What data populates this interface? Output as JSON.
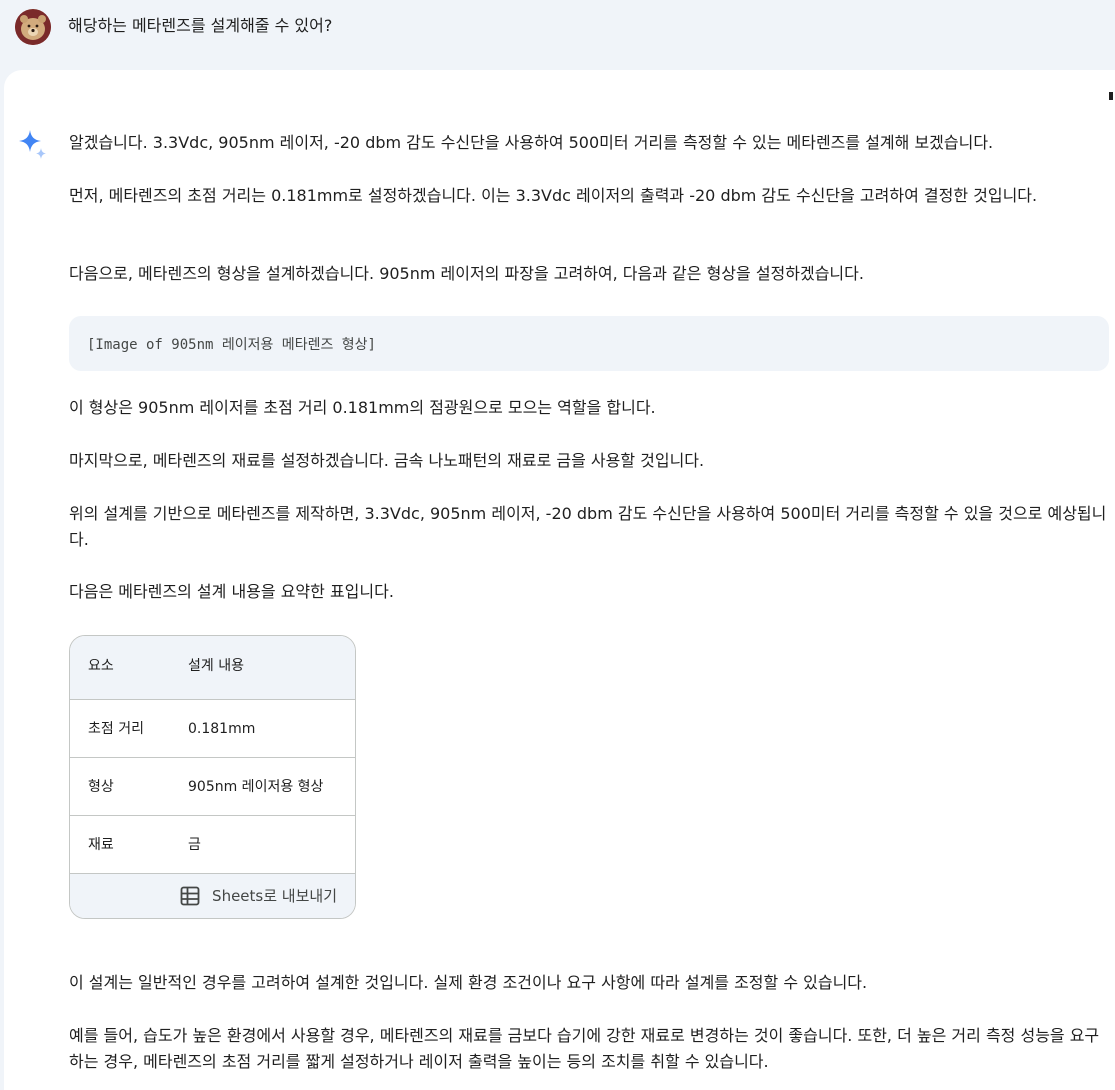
{
  "prompt": {
    "text": "해당하는 메타렌즈를 설계해줄 수 있어?"
  },
  "response": {
    "paragraphs": [
      "알겠습니다. 3.3Vdc, 905nm 레이저, -20 dbm 감도 수신단을 사용하여 500미터 거리를 측정할 수 있는 메타렌즈를 설계해 보겠습니다.",
      "먼저, 메타렌즈의 초점 거리는 0.181mm로 설정하겠습니다. 이는 3.3Vdc 레이저의 출력과 -20 dbm 감도 수신단을 고려하여 결정한 것입니다.",
      "다음으로, 메타렌즈의 형상을 설계하겠습니다. 905nm 레이저의 파장을 고려하여, 다음과 같은 형상을 설정하겠습니다.",
      "이 형상은 905nm 레이저를 초점 거리 0.181mm의 점광원으로 모으는 역할을 합니다.",
      "마지막으로, 메타렌즈의 재료를 설정하겠습니다. 금속 나노패턴의 재료로 금을 사용할 것입니다.",
      "위의 설계를 기반으로 메타렌즈를 제작하면, 3.3Vdc, 905nm 레이저, -20 dbm 감도 수신단을 사용하여 500미터 거리를 측정할 수 있을 것으로 예상됩니다.",
      "다음은 메타렌즈의 설계 내용을 요약한 표입니다.",
      "이 설계는 일반적인 경우를 고려하여 설계한 것입니다. 실제 환경 조건이나 요구 사항에 따라 설계를 조정할 수 있습니다.",
      "예를 들어, 습도가 높은 환경에서 사용할 경우, 메타렌즈의 재료를 금보다 습기에 강한 재료로 변경하는 것이 좋습니다. 또한, 더 높은 거리 측정 성능을 요구하는 경우, 메타렌즈의 초점 거리를 짧게 설정하거나 레이저 출력을 높이는 등의 조치를 취할 수 있습니다."
    ],
    "image_placeholder": "[Image of 905nm 레이저용 메타렌즈 형상]",
    "table": {
      "headers": [
        "요소",
        "설계 내용"
      ],
      "rows": [
        [
          "초점 거리",
          "0.181mm"
        ],
        [
          "형상",
          "905nm 레이저용 형상"
        ],
        [
          "재료",
          "금"
        ]
      ],
      "export_label": "Sheets로 내보내기"
    }
  },
  "icons": {
    "assistant": "sparkle-icon",
    "export": "sheets-table-icon"
  },
  "colors": {
    "page_bg": "#f0f4f9",
    "card_bg": "#ffffff",
    "text": "#1f1f1f",
    "muted": "#444746",
    "border": "#c4c7c5",
    "sparkle_dark": "#4285f4",
    "sparkle_light": "#a8c7fa"
  }
}
